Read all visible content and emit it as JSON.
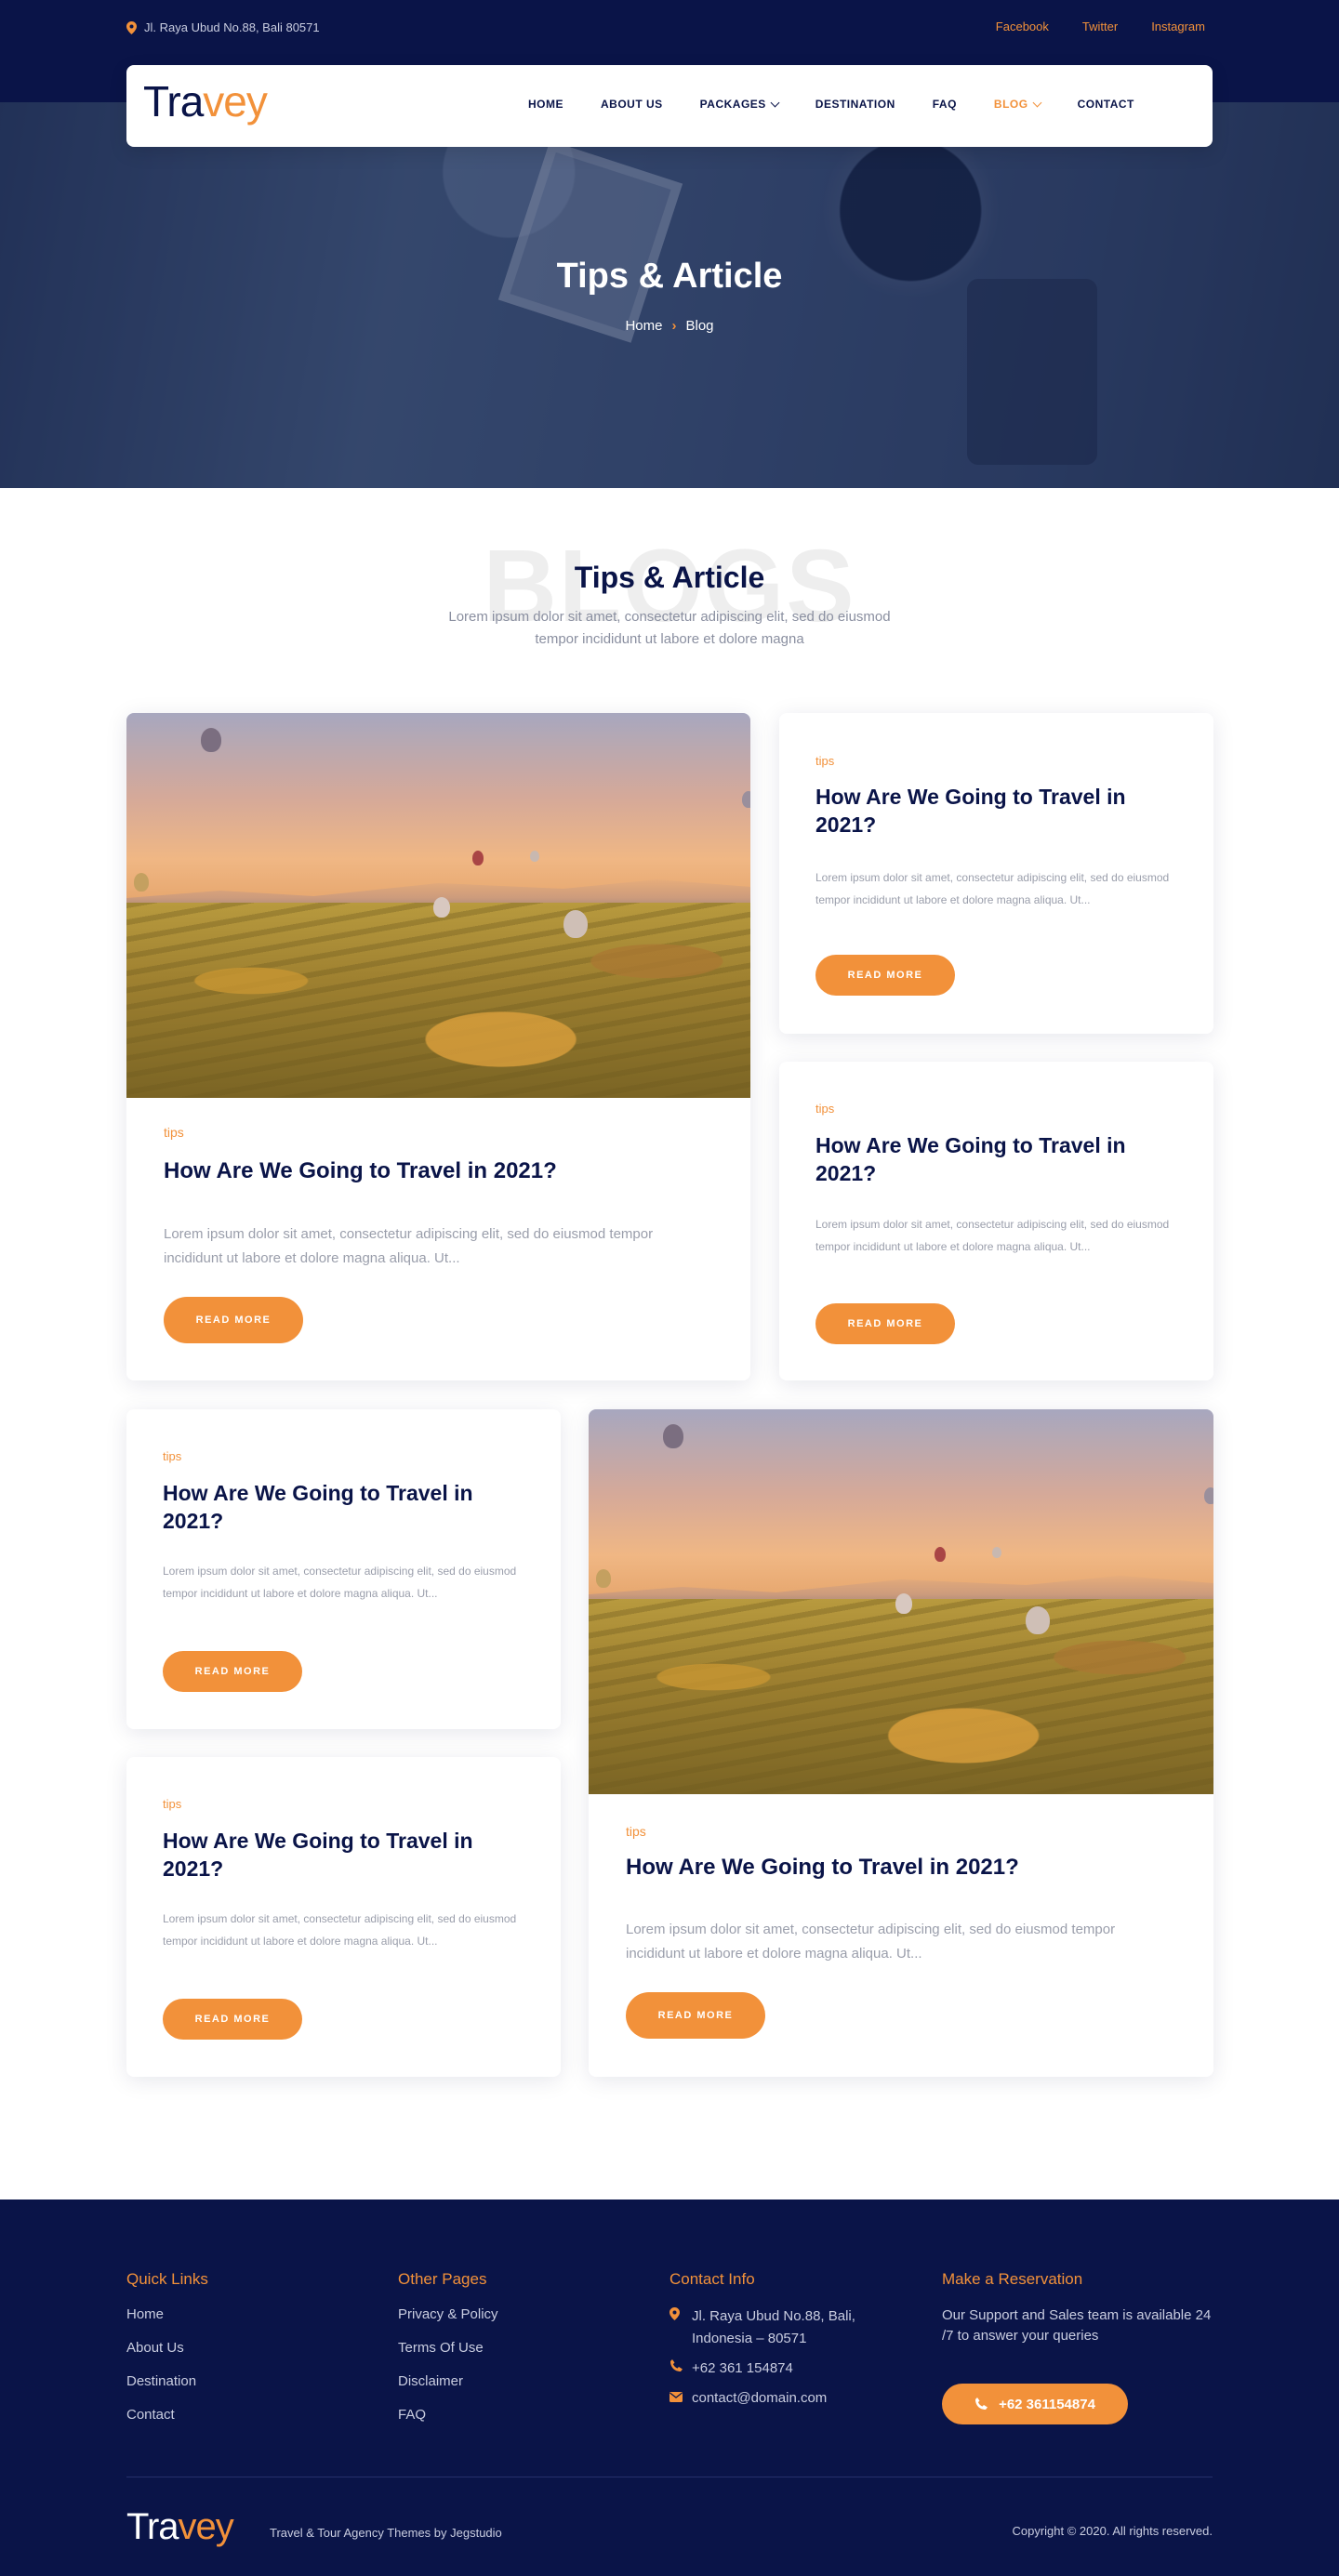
{
  "topbar": {
    "address": "Jl. Raya Ubud No.88, Bali 80571",
    "social": [
      "Facebook",
      "Twitter",
      "Instagram"
    ]
  },
  "nav": {
    "logo_main": "Tra",
    "logo_accent": "vey",
    "items": [
      {
        "label": "HOME",
        "dropdown": false,
        "active": false
      },
      {
        "label": "ABOUT US",
        "dropdown": false,
        "active": false
      },
      {
        "label": "PACKAGES",
        "dropdown": true,
        "active": false
      },
      {
        "label": "DESTINATION",
        "dropdown": false,
        "active": false
      },
      {
        "label": "FAQ",
        "dropdown": false,
        "active": false
      },
      {
        "label": "BLOG",
        "dropdown": true,
        "active": true
      },
      {
        "label": "CONTACT",
        "dropdown": false,
        "active": false
      }
    ]
  },
  "hero": {
    "title": "Tips & Article",
    "breadcrumb": [
      "Home",
      "Blog"
    ]
  },
  "intro": {
    "ghost": "BLOGS",
    "title": "Tips & Article",
    "text": "Lorem ipsum dolor sit amet, consectetur adipiscing elit, sed do eiusmod tempor incididunt ut labore et dolore magna"
  },
  "posts": [
    {
      "tag": "tips",
      "title": "How Are We Going to Travel in 2021?",
      "excerpt": "Lorem ipsum dolor sit amet, consectetur adipiscing elit, sed do eiusmod tempor incididunt ut labore et dolore magna aliqua. Ut...",
      "button": "READ MORE"
    },
    {
      "tag": "tips",
      "title": "How Are We Going to Travel in 2021?",
      "excerpt": "Lorem ipsum dolor sit amet, consectetur adipiscing elit, sed do eiusmod tempor incididunt ut labore et dolore magna aliqua. Ut...",
      "button": "READ MORE"
    },
    {
      "tag": "tips",
      "title": "How Are We Going to Travel in 2021?",
      "excerpt": "Lorem ipsum dolor sit amet, consectetur adipiscing elit, sed do eiusmod tempor incididunt ut labore et dolore magna aliqua. Ut...",
      "button": "READ MORE"
    },
    {
      "tag": "tips",
      "title": "How Are We Going to Travel in 2021?",
      "excerpt": "Lorem ipsum dolor sit amet, consectetur adipiscing elit, sed do eiusmod tempor incididunt ut labore et dolore magna aliqua. Ut...",
      "button": "READ MORE"
    },
    {
      "tag": "tips",
      "title": "How Are We Going to Travel in 2021?",
      "excerpt": "Lorem ipsum dolor sit amet, consectetur adipiscing elit, sed do eiusmod tempor incididunt ut labore et dolore magna aliqua. Ut...",
      "button": "READ MORE"
    },
    {
      "tag": "tips",
      "title": "How Are We Going to Travel in 2021?",
      "excerpt": "Lorem ipsum dolor sit amet, consectetur adipiscing elit, sed do eiusmod tempor incididunt ut labore et dolore magna aliqua. Ut...",
      "button": "READ MORE"
    }
  ],
  "footer": {
    "quick_links": {
      "title": "Quick Links",
      "items": [
        "Home",
        "About Us",
        "Destination",
        "Contact"
      ]
    },
    "other_pages": {
      "title": "Other Pages",
      "items": [
        "Privacy & Policy",
        "Terms Of Use",
        "Disclaimer",
        "FAQ"
      ]
    },
    "contact": {
      "title": "Contact Info",
      "address": "Jl. Raya Ubud No.88, Bali, Indonesia – 80571",
      "phone": "+62 361 154874",
      "email": "contact@domain.com"
    },
    "reservation": {
      "title": "Make a Reservation",
      "text": "Our Support and Sales team is available 24 /7 to answer your queries",
      "button": "+62 361154874"
    },
    "logo_main": "Tra",
    "logo_accent": "vey",
    "tagline": "Travel & Tour Agency Themes by Jegstudio",
    "copyright": "Copyright © 2020. All rights reserved."
  },
  "colors": {
    "navy": "#0a1448",
    "accent": "#f2913a"
  }
}
